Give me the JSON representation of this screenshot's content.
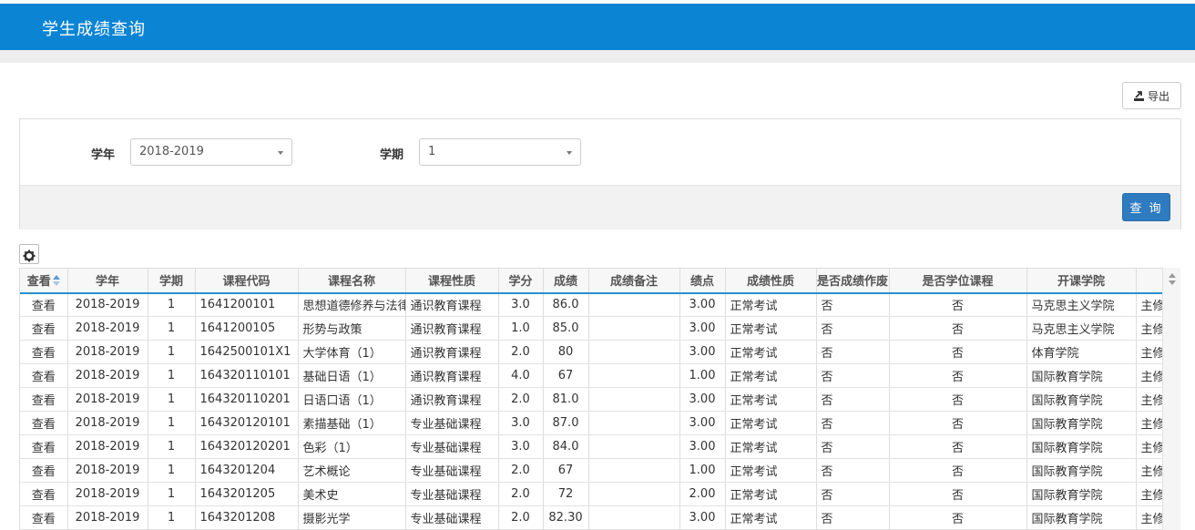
{
  "header": {
    "title": "学生成绩查询"
  },
  "toolbar": {
    "export_label": "导出",
    "export_icon": "export-icon"
  },
  "filters": {
    "year_label": "学年",
    "year_value": "2018-2019",
    "term_label": "学期",
    "term_value": "1",
    "query_label": "查 询"
  },
  "grid": {
    "columns": [
      "查看",
      "学年",
      "学期",
      "课程代码",
      "课程名称",
      "课程性质",
      "学分",
      "成绩",
      "成绩备注",
      "绩点",
      "成绩性质",
      "是否成绩作废",
      "是否学位课程",
      "开课学院",
      ""
    ],
    "view_label": "查看",
    "rows": [
      [
        "2018-2019",
        "1",
        "1641200101",
        "思想道德修养与法律基础",
        "通识教育课程",
        "3.0",
        "86.0",
        "",
        "3.00",
        "正常考试",
        "否",
        "否",
        "马克思主义学院",
        "主修"
      ],
      [
        "2018-2019",
        "1",
        "1641200105",
        "形势与政策",
        "通识教育课程",
        "1.0",
        "85.0",
        "",
        "3.00",
        "正常考试",
        "否",
        "否",
        "马克思主义学院",
        "主修"
      ],
      [
        "2018-2019",
        "1",
        "1642500101X1",
        "大学体育（1）",
        "通识教育课程",
        "2.0",
        "80",
        "",
        "3.00",
        "正常考试",
        "否",
        "否",
        "体育学院",
        "主修"
      ],
      [
        "2018-2019",
        "1",
        "164320110101",
        "基础日语（1）",
        "通识教育课程",
        "4.0",
        "67",
        "",
        "1.00",
        "正常考试",
        "否",
        "否",
        "国际教育学院",
        "主修"
      ],
      [
        "2018-2019",
        "1",
        "164320110201",
        "日语口语（1）",
        "通识教育课程",
        "2.0",
        "81.0",
        "",
        "3.00",
        "正常考试",
        "否",
        "否",
        "国际教育学院",
        "主修"
      ],
      [
        "2018-2019",
        "1",
        "164320120101",
        "素描基础（1）",
        "专业基础课程",
        "3.0",
        "87.0",
        "",
        "3.00",
        "正常考试",
        "否",
        "否",
        "国际教育学院",
        "主修"
      ],
      [
        "2018-2019",
        "1",
        "164320120201",
        "色彩（1）",
        "专业基础课程",
        "3.0",
        "84.0",
        "",
        "3.00",
        "正常考试",
        "否",
        "否",
        "国际教育学院",
        "主修"
      ],
      [
        "2018-2019",
        "1",
        "1643201204",
        "艺术概论",
        "专业基础课程",
        "2.0",
        "67",
        "",
        "1.00",
        "正常考试",
        "否",
        "否",
        "国际教育学院",
        "主修"
      ],
      [
        "2018-2019",
        "1",
        "1643201205",
        "美术史",
        "专业基础课程",
        "2.0",
        "72",
        "",
        "2.00",
        "正常考试",
        "否",
        "否",
        "国际教育学院",
        "主修"
      ],
      [
        "2018-2019",
        "1",
        "1643201208",
        "摄影光学",
        "专业基础课程",
        "2.0",
        "82.30",
        "",
        "3.00",
        "正常考试",
        "否",
        "否",
        "国际教育学院",
        "主修"
      ]
    ]
  }
}
